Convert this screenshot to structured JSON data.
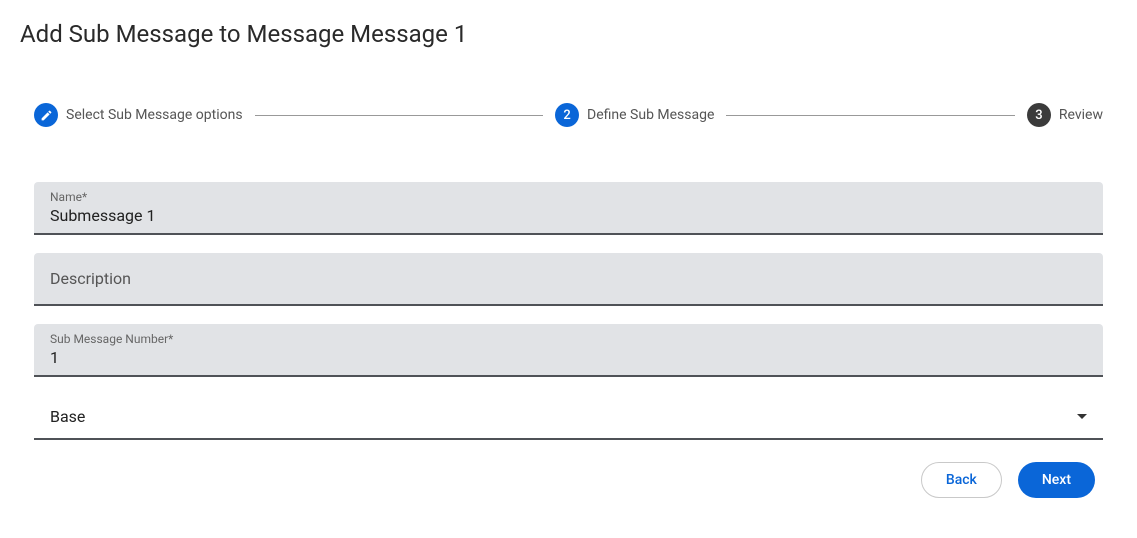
{
  "header": {
    "title": "Add Sub Message to Message Message 1"
  },
  "stepper": {
    "step1": {
      "label": "Select Sub Message options",
      "state": "done"
    },
    "step2": {
      "label": "Define Sub Message",
      "state": "active",
      "number": "2"
    },
    "step3": {
      "label": "Review",
      "state": "pending",
      "number": "3"
    }
  },
  "form": {
    "name": {
      "label": "Name*",
      "value": "Submessage 1"
    },
    "description": {
      "placeholder": "Description",
      "value": ""
    },
    "subMessageNumber": {
      "label": "Sub Message Number*",
      "value": "1"
    },
    "typeSelect": {
      "value": "Base"
    }
  },
  "actions": {
    "back": "Back",
    "next": "Next"
  }
}
